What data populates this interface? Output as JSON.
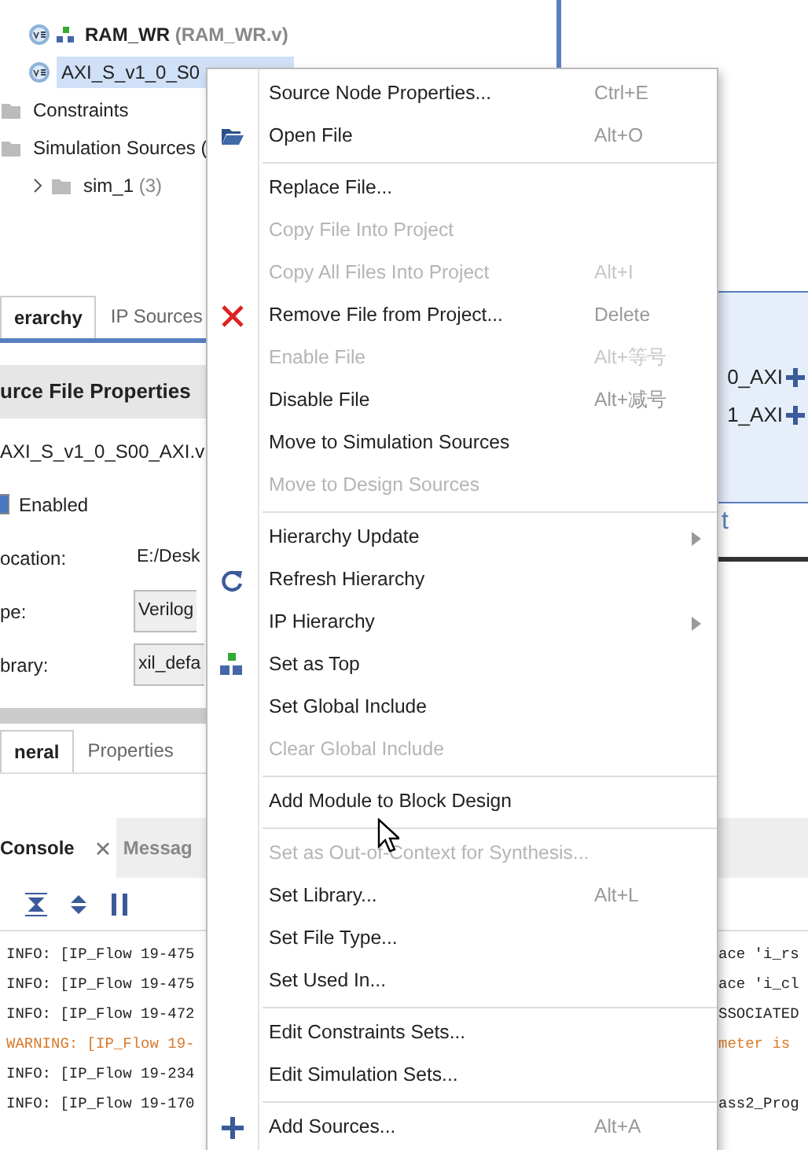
{
  "tree": [
    {
      "kind": "module",
      "label": "RAM_WR",
      "detail": "(RAM_WR.v)",
      "top": true,
      "selected": false
    },
    {
      "kind": "module",
      "label": "AXI_S_v1_0_S0",
      "top": false,
      "selected": true
    },
    {
      "kind": "folder",
      "label": "Constraints",
      "selected": false
    },
    {
      "kind": "folder",
      "label": "Simulation Sources (",
      "selected": false,
      "children": [
        {
          "kind": "folder",
          "label": "sim_1",
          "detail": "(3)",
          "expanded": false,
          "selected": false
        }
      ]
    }
  ],
  "source_tabs": [
    {
      "label": "erarchy",
      "selected": true
    },
    {
      "label": "IP Sources",
      "selected": false
    }
  ],
  "properties": {
    "title": "urce File Properties",
    "file": "AXI_S_v1_0_S00_AXI.v",
    "enabled_label": "Enabled",
    "enabled_checked": true,
    "fields": [
      {
        "kind": "text",
        "label": "ocation:",
        "value": "E:/Desk"
      },
      {
        "kind": "select",
        "label": "pe:",
        "value": "Verilog"
      },
      {
        "kind": "select",
        "label": "brary:",
        "value": "xil_defa"
      }
    ],
    "tabs": [
      {
        "label": "neral",
        "selected": true
      },
      {
        "label": "Properties",
        "selected": false
      }
    ]
  },
  "diagram": {
    "ports": [
      "0_AXI",
      "1_AXI"
    ],
    "fragment": "t"
  },
  "console": {
    "tabs": [
      {
        "label": "Console",
        "selected": true
      },
      {
        "label": "Messag",
        "selected": false
      }
    ],
    "lines": [
      {
        "kind": "info",
        "text": "INFO: [IP_Flow 19-475",
        "tail": "ace 'i_rs"
      },
      {
        "kind": "info",
        "text": "INFO: [IP_Flow 19-475",
        "tail": "ace 'i_cl"
      },
      {
        "kind": "info",
        "text": "INFO: [IP_Flow 19-472",
        "tail": "SSOCIATED"
      },
      {
        "kind": "warning",
        "text": "WARNING: [IP_Flow 19-",
        "tail": "meter is"
      },
      {
        "kind": "info",
        "text": "INFO: [IP_Flow 19-234"
      },
      {
        "kind": "info",
        "text": "INFO: [IP_Flow 19-170",
        "tail": "ass2_Prog"
      }
    ]
  },
  "context_menu": [
    {
      "kind": "item",
      "label": "Source Node Properties...",
      "shortcut": "Ctrl+E",
      "disabled": false
    },
    {
      "kind": "item",
      "label": "Open File",
      "shortcut": "Alt+O",
      "disabled": false
    },
    {
      "kind": "separator"
    },
    {
      "kind": "item",
      "label": "Replace File...",
      "disabled": false
    },
    {
      "kind": "item",
      "label": "Copy File Into Project",
      "disabled": true
    },
    {
      "kind": "item",
      "label": "Copy All Files Into Project",
      "shortcut": "Alt+I",
      "disabled": true
    },
    {
      "kind": "item",
      "label": "Remove File from Project...",
      "shortcut": "Delete",
      "disabled": false
    },
    {
      "kind": "item",
      "label": "Enable File",
      "shortcut": "Alt+等号",
      "disabled": true
    },
    {
      "kind": "item",
      "label": "Disable File",
      "shortcut": "Alt+减号",
      "disabled": false
    },
    {
      "kind": "item",
      "label": "Move to Simulation Sources",
      "disabled": false
    },
    {
      "kind": "item",
      "label": "Move to Design Sources",
      "disabled": true
    },
    {
      "kind": "separator"
    },
    {
      "kind": "item",
      "label": "Hierarchy Update",
      "submenu": true,
      "disabled": false
    },
    {
      "kind": "item",
      "label": "Refresh Hierarchy",
      "disabled": false
    },
    {
      "kind": "item",
      "label": "IP Hierarchy",
      "submenu": true,
      "disabled": false
    },
    {
      "kind": "item",
      "label": "Set as Top",
      "disabled": false
    },
    {
      "kind": "item",
      "label": "Set Global Include",
      "disabled": false
    },
    {
      "kind": "item",
      "label": "Clear Global Include",
      "disabled": true
    },
    {
      "kind": "separator"
    },
    {
      "kind": "item",
      "label": "Add Module to Block Design",
      "disabled": false
    },
    {
      "kind": "separator"
    },
    {
      "kind": "item",
      "label": "Set as Out-of-Context for Synthesis...",
      "disabled": true
    },
    {
      "kind": "item",
      "label": "Set Library...",
      "shortcut": "Alt+L",
      "disabled": false
    },
    {
      "kind": "item",
      "label": "Set File Type...",
      "disabled": false
    },
    {
      "kind": "item",
      "label": "Set Used In...",
      "disabled": false
    },
    {
      "kind": "separator"
    },
    {
      "kind": "item",
      "label": "Edit Constraints Sets...",
      "disabled": false
    },
    {
      "kind": "item",
      "label": "Edit Simulation Sets...",
      "disabled": false
    },
    {
      "kind": "separator"
    },
    {
      "kind": "item",
      "label": "Add Sources...",
      "shortcut": "Alt+A",
      "disabled": false
    }
  ]
}
